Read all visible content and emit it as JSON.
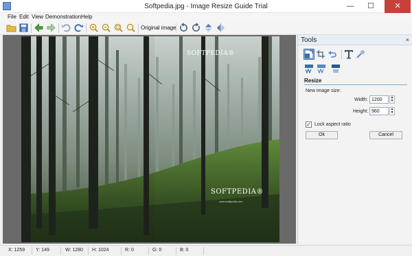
{
  "window": {
    "title": "Softpedia.jpg - Image Resize Guide Trial",
    "minimize": "—",
    "maximize": "☐",
    "close": "✕"
  },
  "menu": [
    "File",
    "Edit",
    "View",
    "Demonstration",
    "Help"
  ],
  "toolbar": {
    "original_image_label": "Original image"
  },
  "image": {
    "watermark_top": "SOFTPEDIA®",
    "watermark_bottom": "SOFTPEDIA®",
    "watermark_url": "www.softpedia.com"
  },
  "tools": {
    "title": "Tools",
    "close": "×",
    "resize_heading": "Resize",
    "new_size_label": "New image size:",
    "width_label": "Width:",
    "width_value": "1200",
    "height_label": "Height:",
    "height_value": "960",
    "lock_label": "Lock aspect ratio",
    "lock_checked": "✓",
    "ok_label": "Ok",
    "cancel_label": "Cancel"
  },
  "status": {
    "x": "X: 1259",
    "y": "Y: 149",
    "w": "W: 1280",
    "h": "H: 1024",
    "r": "R: 0",
    "g": "G: 0",
    "b": "B: 0"
  },
  "colors": {
    "accent": "#3a6fb0",
    "close": "#c7403a",
    "canvas_bg": "#6a6a6a"
  }
}
